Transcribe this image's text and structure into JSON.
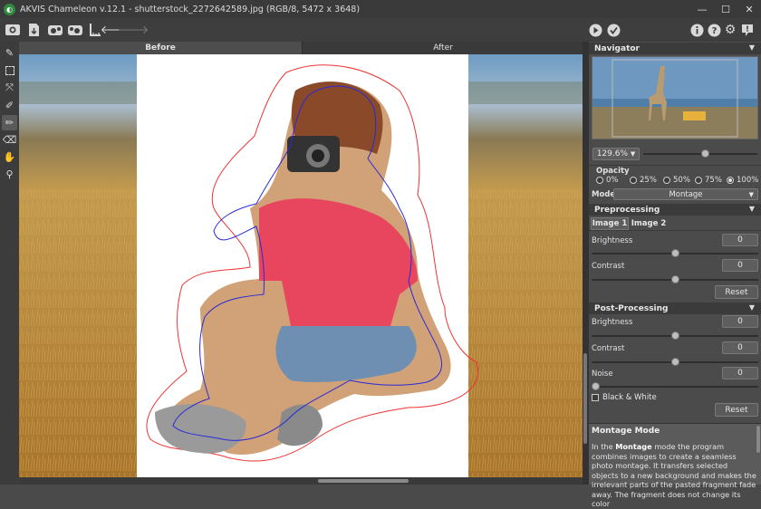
{
  "window": {
    "title": "AKVIS Chameleon v.12.1 - shutterstock_2272642589.jpg (RGB/8, 5472 x 3648)"
  },
  "tabs": {
    "before": "Before",
    "after": "After"
  },
  "navigator": {
    "title": "Navigator",
    "zoom": "129.6%"
  },
  "opacity": {
    "label": "Opacity",
    "options": [
      "0%",
      "25%",
      "50%",
      "75%",
      "100%"
    ],
    "selected": "100%"
  },
  "mode": {
    "label": "Mode",
    "value": "Montage"
  },
  "preprocessing": {
    "title": "Preprocessing",
    "tabs": [
      "Image 1",
      "Image 2"
    ],
    "brightness_label": "Brightness",
    "brightness_value": "0",
    "contrast_label": "Contrast",
    "contrast_value": "0",
    "reset_label": "Reset"
  },
  "postprocessing": {
    "title": "Post-Processing",
    "brightness_label": "Brightness",
    "brightness_value": "0",
    "contrast_label": "Contrast",
    "contrast_value": "0",
    "noise_label": "Noise",
    "noise_value": "0",
    "bw_label": "Black & White",
    "reset_label": "Reset"
  },
  "sliders": {
    "zoom": 0.55,
    "pre_brightness": 0.5,
    "pre_contrast": 0.5,
    "post_brightness": 0.5,
    "post_contrast": 0.5,
    "post_noise": 0
  },
  "help": {
    "title": "Montage Mode",
    "text_a": "In the ",
    "text_bold": "Montage",
    "text_b": " mode the program combines images to create a seamless photo montage. It transfers selected objects to a new background and makes the irrelevant parts of the pasted fragment fade away. The fragment does not change its color"
  },
  "icons": [
    "open-image-icon",
    "save-icon",
    "load-object-icon",
    "load-background-icon",
    "run-icon",
    "apply-icon",
    "info-icon",
    "help-icon",
    "settings-icon",
    "notifications-icon"
  ]
}
